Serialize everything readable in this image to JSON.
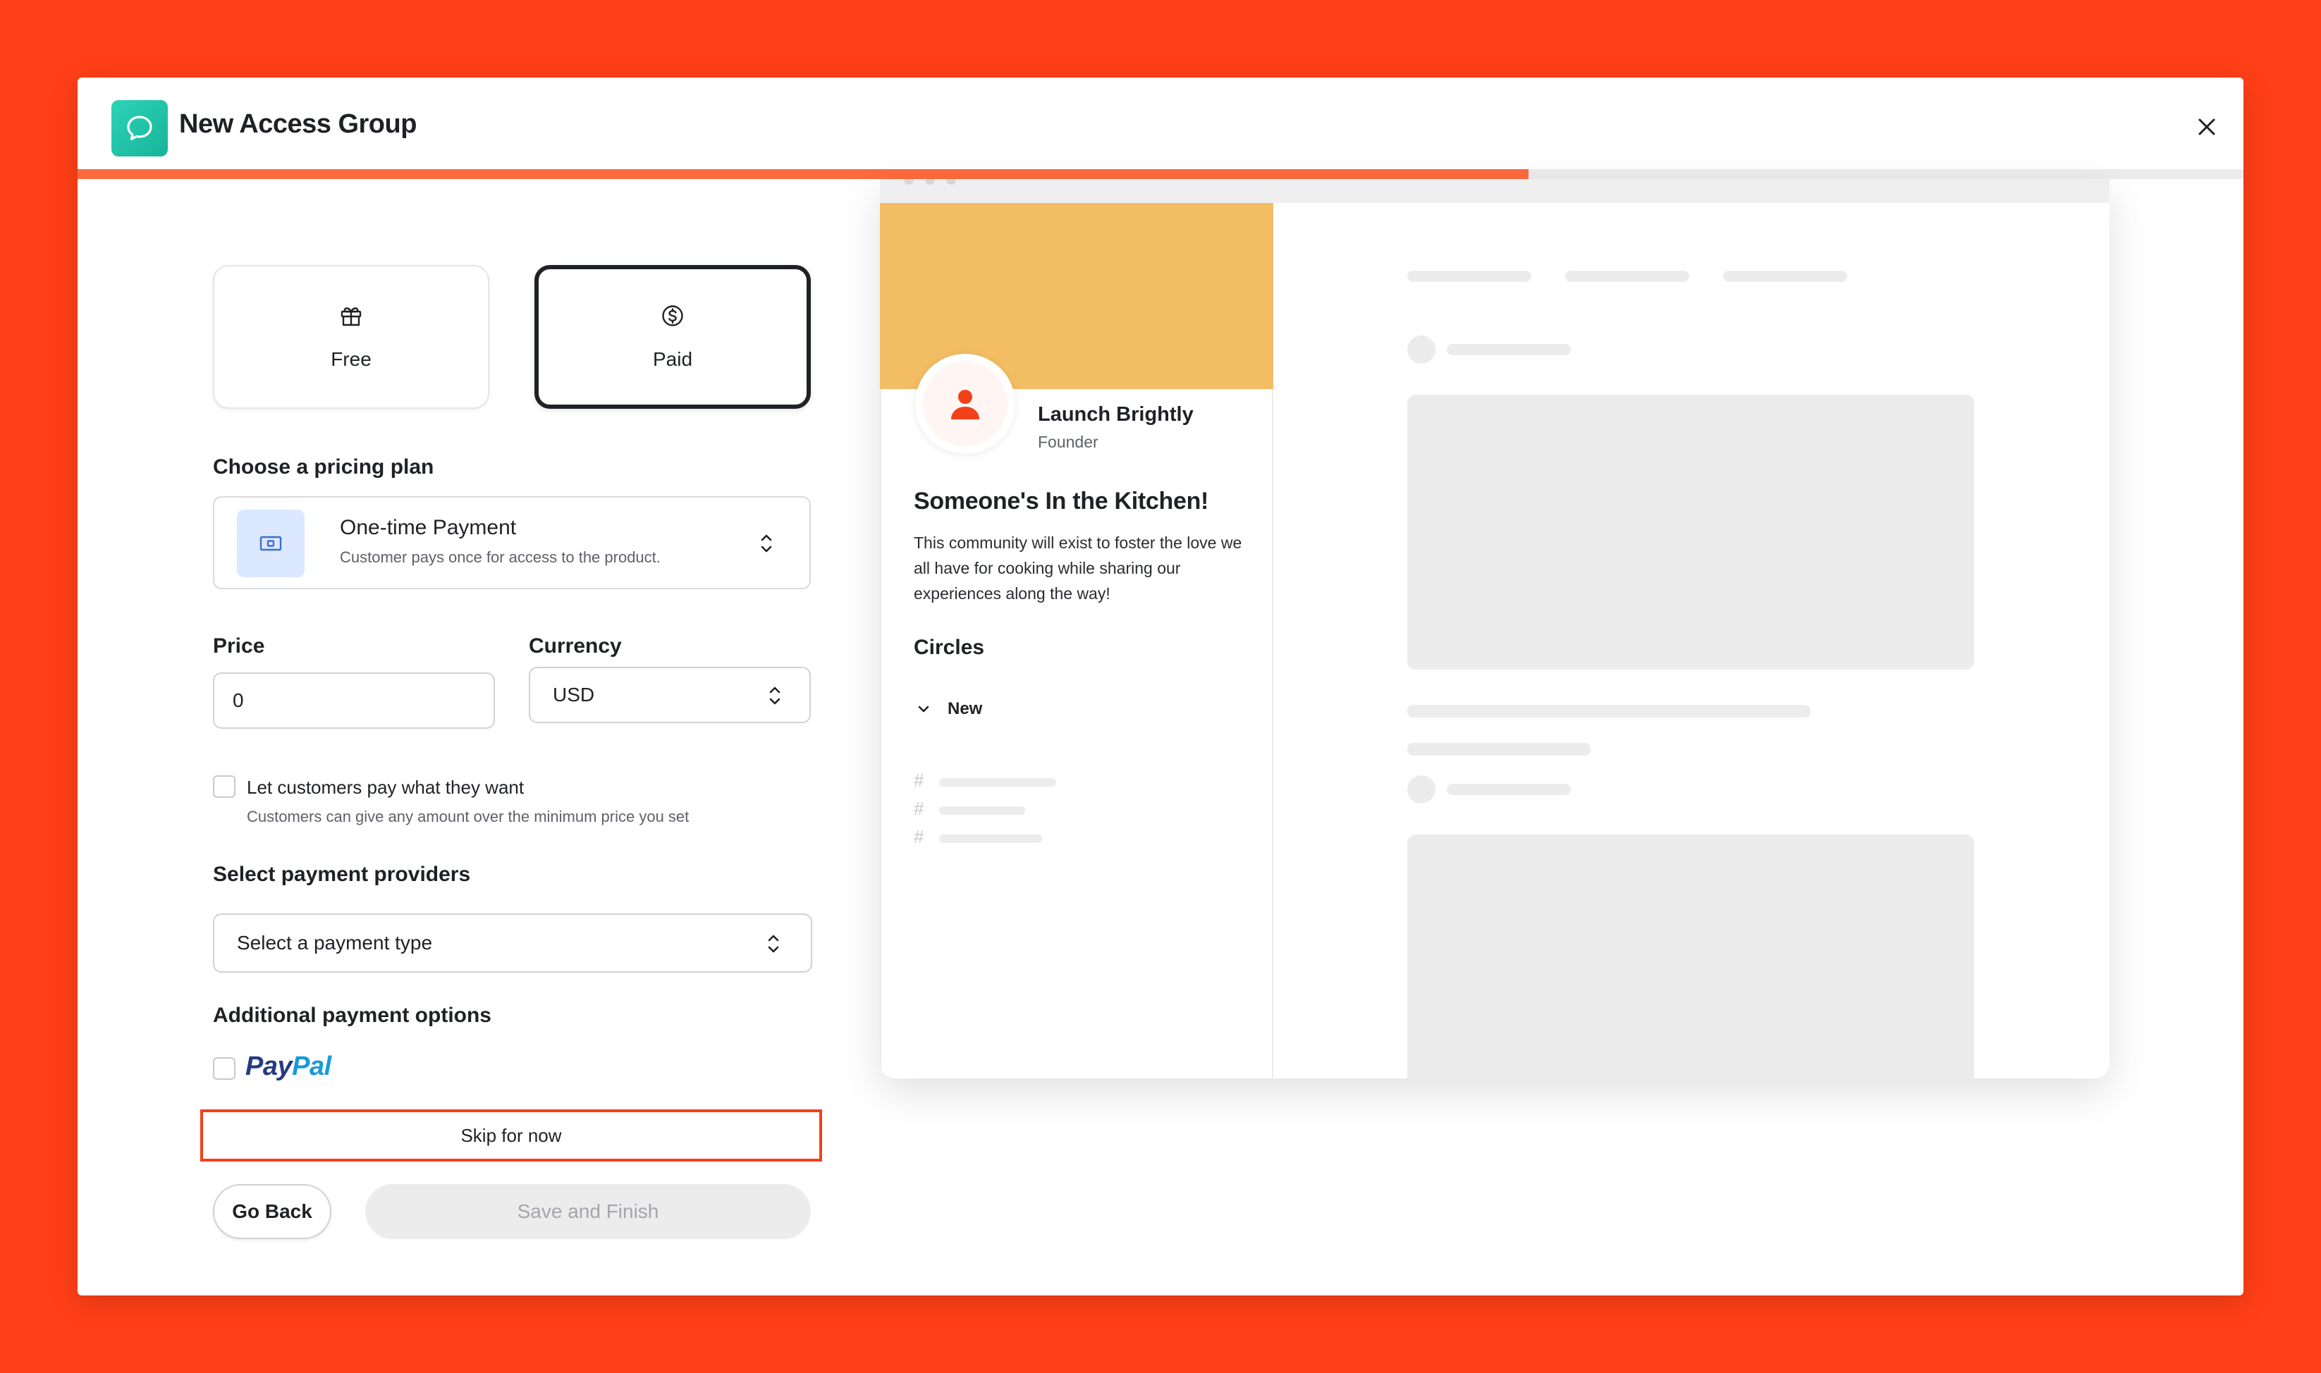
{
  "colors": {
    "background": "#FF3F17",
    "accent": "#FF6A3D",
    "highlight_border": "#F2401B",
    "cover": "#F2BD63",
    "app_icon": "#16b49a",
    "paypal_dark": "#253B80",
    "paypal_light": "#179BD7"
  },
  "modal": {
    "title": "New Access Group",
    "app_icon": "chat-bubble-icon",
    "close_icon": "close-icon",
    "progress": 0.67
  },
  "access_type": {
    "options": [
      {
        "label": "Free",
        "icon": "gift-icon",
        "selected": false
      },
      {
        "label": "Paid",
        "icon": "dollar-coin-icon",
        "selected": true
      }
    ]
  },
  "pricing_plan": {
    "label": "Choose a pricing plan",
    "selected_title": "One-time Payment",
    "selected_description": "Customer pays once for access to the product.",
    "icon": "cash-icon"
  },
  "price": {
    "label": "Price",
    "value": "0"
  },
  "currency": {
    "label": "Currency",
    "value": "USD"
  },
  "pay_what_they_want": {
    "label": "Let customers pay what they want",
    "help": "Customers can give any amount over the minimum price you set",
    "checked": false
  },
  "payment_providers": {
    "label": "Select payment providers",
    "placeholder": "Select a payment type"
  },
  "additional_options": {
    "label": "Additional payment options",
    "paypal_part1": "Pay",
    "paypal_part2": "Pal",
    "paypal_checked": false
  },
  "actions": {
    "skip": "Skip for now",
    "back": "Go Back",
    "save": "Save and Finish"
  },
  "preview": {
    "name": "Launch Brightly",
    "role": "Founder",
    "title": "Someone's In the Kitchen!",
    "description": "This community will exist to foster the love we all have for cooking while sharing our experiences along the way!",
    "circles_label": "Circles",
    "group_label": "New",
    "hash": "#"
  }
}
